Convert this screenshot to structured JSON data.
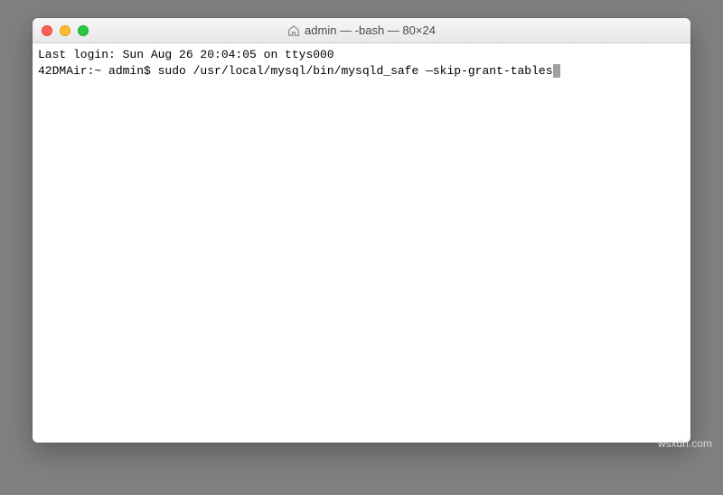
{
  "window": {
    "title": "admin — -bash — 80×24",
    "icon": "home-icon"
  },
  "terminal": {
    "line1": "Last login: Sun Aug 26 20:04:05 on ttys000",
    "prompt": "42DMAir:~ admin$ ",
    "command": "sudo /usr/local/mysql/bin/mysqld_safe —skip-grant-tables"
  },
  "watermark": "wsxdn.com"
}
